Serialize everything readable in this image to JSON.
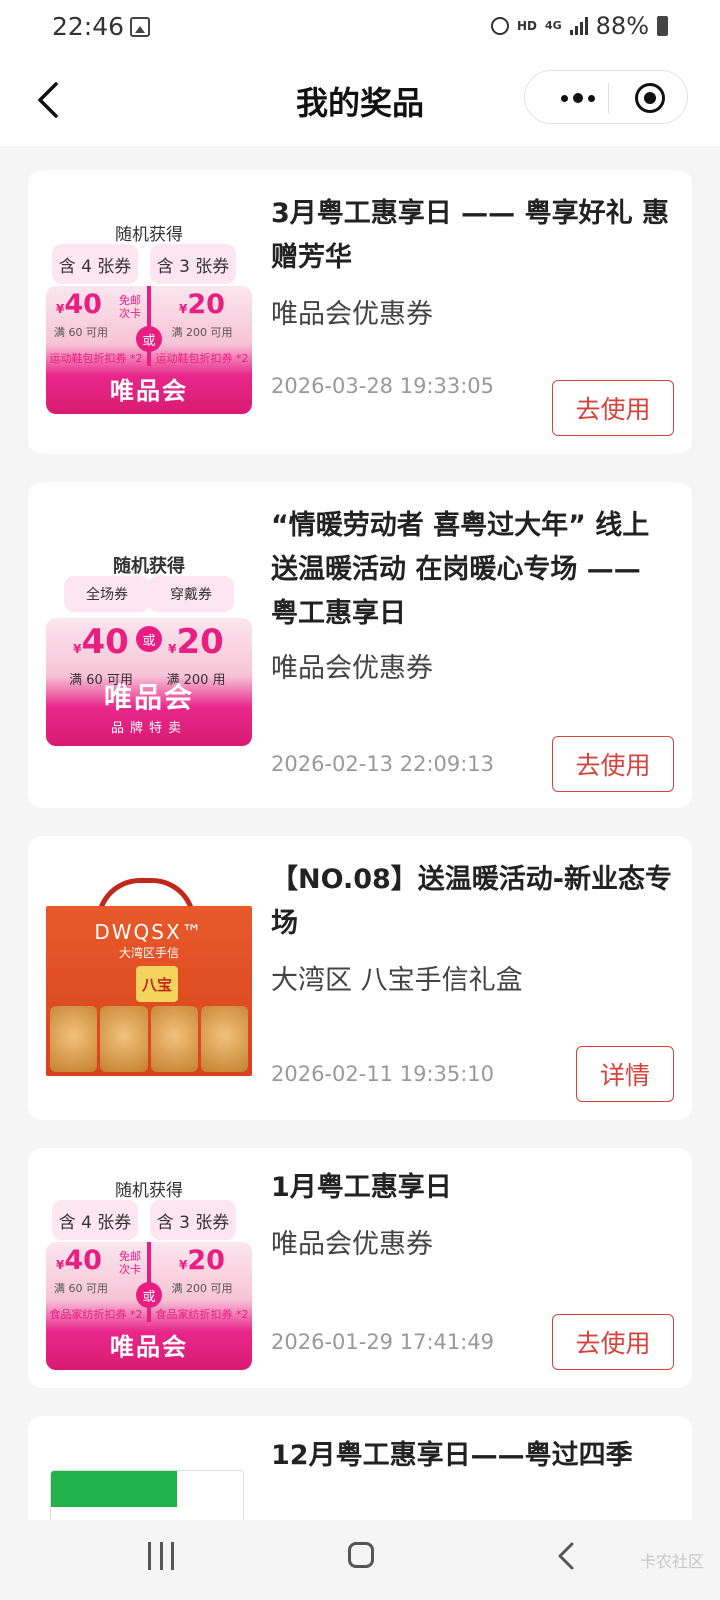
{
  "status_bar": {
    "time": "22:46",
    "hd": "HD",
    "network": "4G",
    "battery": "88%"
  },
  "nav": {
    "title": "我的奖品"
  },
  "colors": {
    "accent": "#d4443c",
    "brand_pink": "#e91e82"
  },
  "items": [
    {
      "title": "3月粤工惠享日 —— 粤享好礼 惠赠芳华",
      "subtitle": "唯品会优惠券",
      "date": "2026-03-28 19:33:05",
      "button": "去使用",
      "thumb": {
        "head": "随机获得",
        "tab_left": "含 4 张券",
        "tab_right": "含 3 张券",
        "left_amount": "40",
        "left_cond": "满 60 可用",
        "left_tag": "免邮次卡",
        "left_extra": "运动鞋包折扣券 *2",
        "right_amount": "20",
        "right_cond": "满 200 可用",
        "right_extra": "运动鞋包折扣券 *2",
        "or": "或",
        "brand": "唯品会",
        "currency": "¥"
      }
    },
    {
      "title": "“情暖劳动者 喜粤过大年” 线上送温暖活动 在岗暖心专场 —— 粤工惠享日",
      "subtitle": "唯品会优惠券",
      "date": "2026-02-13 22:09:13",
      "button": "去使用",
      "thumb": {
        "head": "随机获得",
        "tab_left": "全场券",
        "tab_right": "穿戴券",
        "left_amount": "40",
        "left_cond": "满 60 可用",
        "right_amount": "20",
        "right_cond": "满 200 用",
        "or": "或",
        "brand": "唯品会",
        "brand_sub": "品牌特卖",
        "currency": "¥"
      }
    },
    {
      "title": "【NO.08】送温暖活动-新业态专场",
      "subtitle": "大湾区 八宝手信礼盒",
      "date": "2026-02-11 19:35:10",
      "button": "详情",
      "thumb": {
        "brand": "DWQSX™",
        "brand_sub": "大湾区手信",
        "label": "八宝"
      }
    },
    {
      "title": "1月粤工惠享日",
      "subtitle": "唯品会优惠券",
      "date": "2026-01-29 17:41:49",
      "button": "去使用",
      "thumb": {
        "head": "随机获得",
        "tab_left": "含 4 张券",
        "tab_right": "含 3 张券",
        "left_amount": "40",
        "left_cond": "满 60 可用",
        "left_tag": "免邮次卡",
        "left_extra": "食品家纺折扣券 *2",
        "right_amount": "20",
        "right_cond": "满 200 可用",
        "right_extra": "食品家纺折扣券 *2",
        "or": "或",
        "brand": "唯品会",
        "currency": "¥"
      }
    },
    {
      "title": "12月粤工惠享日——粤过四季"
    }
  ],
  "watermark": "卡农社区"
}
